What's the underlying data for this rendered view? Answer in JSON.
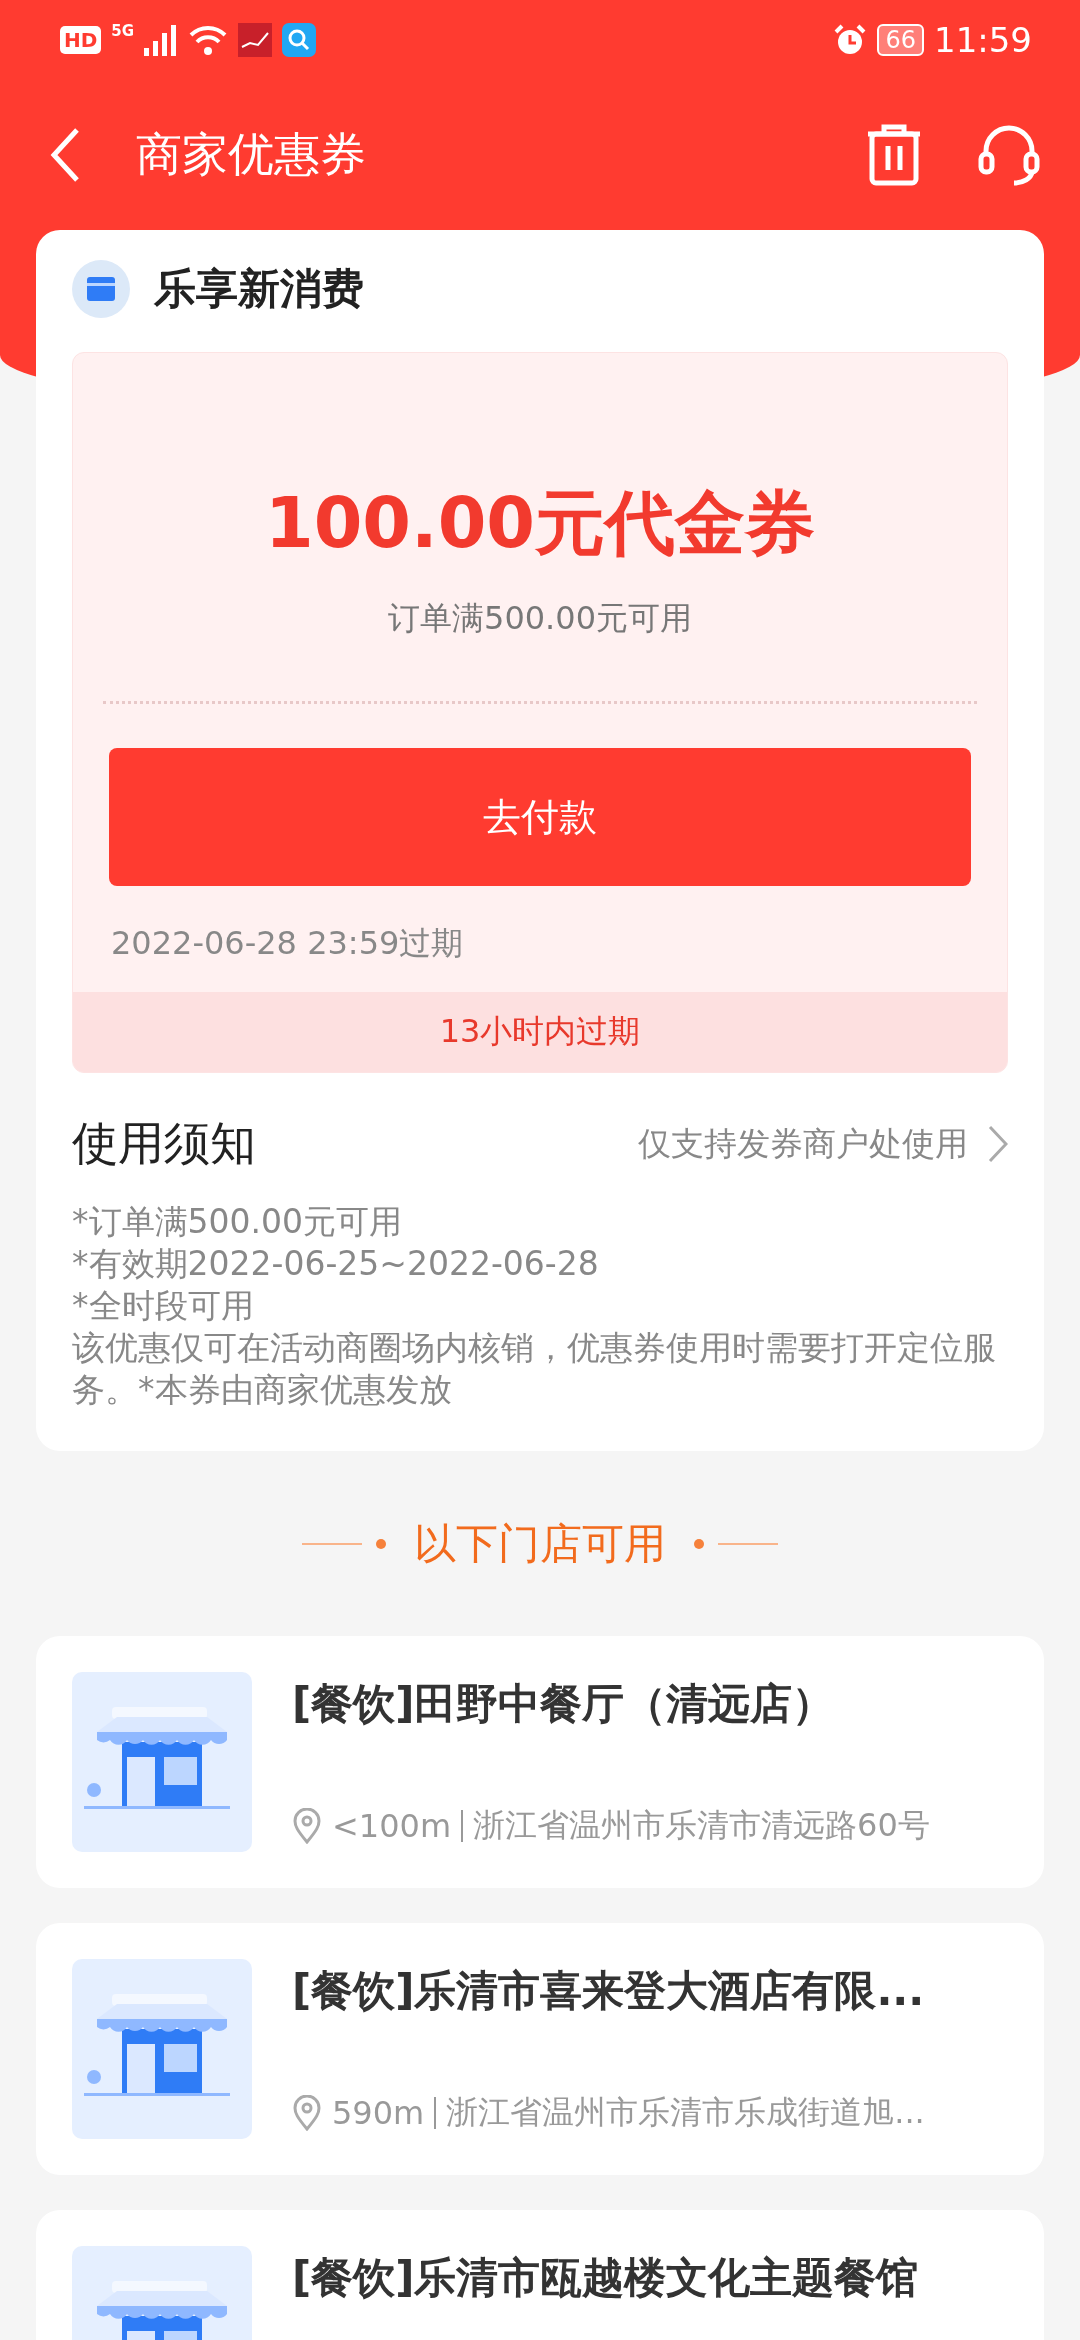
{
  "status_bar": {
    "hd": "HD",
    "network": "5G",
    "battery": "66",
    "time": "11:59"
  },
  "header": {
    "title": "商家优惠券"
  },
  "coupon": {
    "merchant": "乐享新消费",
    "amount": "100.00元代金券",
    "condition": "订单满500.00元可用",
    "pay_button": "去付款",
    "expiry": "2022-06-28 23:59过期",
    "expiry_notice": "13小时内过期"
  },
  "notice": {
    "title": "使用须知",
    "scope": "仅支持发券商户处使用",
    "lines": [
      "*订单满500.00元可用",
      "*有效期2022-06-25~2022-06-28",
      "*全时段可用",
      "该优惠仅可在活动商圈场内核销，优惠券使用时需要打开定位服务。*本券由商家优惠发放"
    ]
  },
  "stores_heading": "以下门店可用",
  "stores": [
    {
      "name": "[餐饮]田野中餐厅（清远店）",
      "distance": "<100m",
      "address": "浙江省温州市乐清市清远路60号"
    },
    {
      "name": "[餐饮]乐清市喜来登大酒店有限...",
      "distance": "590m",
      "address": "浙江省温州市乐清市乐成街道旭..."
    },
    {
      "name": "[餐饮]乐清市瓯越楼文化主题餐馆"
    }
  ]
}
